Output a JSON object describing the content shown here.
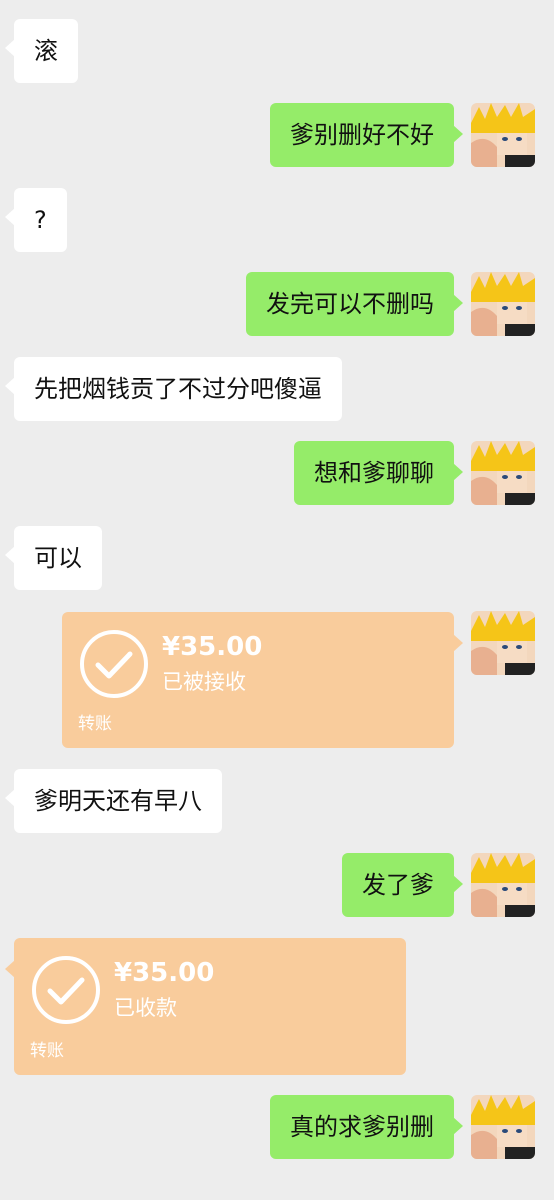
{
  "messages": [
    {
      "side": "left",
      "text": "滚"
    },
    {
      "side": "right",
      "text": "爹别删好不好"
    },
    {
      "side": "left",
      "text": "?"
    },
    {
      "side": "right",
      "text": "发完可以不删吗"
    },
    {
      "side": "left",
      "text": "先把烟钱贡了不过分吧傻逼"
    },
    {
      "side": "right",
      "text": "想和爹聊聊"
    },
    {
      "side": "left",
      "text": "可以"
    },
    {
      "side": "right",
      "type": "transfer",
      "amount": "¥35.00",
      "status": "已被接收",
      "label": "转账"
    },
    {
      "side": "left",
      "text": "爹明天还有早八"
    },
    {
      "side": "right",
      "text": "发了爹"
    },
    {
      "side": "left",
      "type": "transfer",
      "amount": "¥35.00",
      "status": "已收款",
      "label": "转账"
    },
    {
      "side": "right",
      "text": "真的求爹别删"
    }
  ],
  "colors": {
    "background": "#ededed",
    "bubble_left": "#ffffff",
    "bubble_right": "#95ec69",
    "transfer": "#f9cc9c"
  },
  "icons": {
    "avatar": "avatar-icon",
    "transfer_check": "check-circle-icon"
  }
}
